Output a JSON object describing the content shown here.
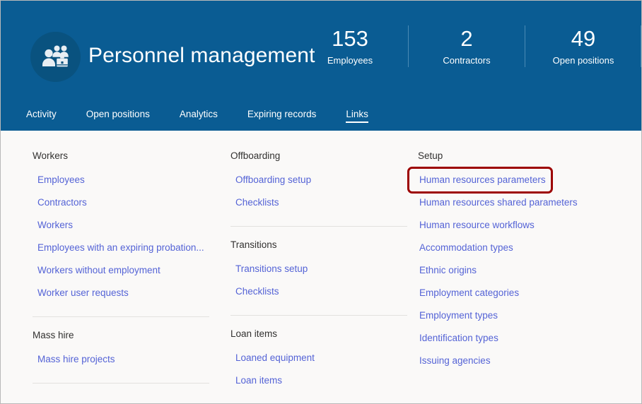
{
  "header": {
    "title": "Personnel management",
    "logo_icon": "people-briefcase-icon",
    "brand_color": "#0a5c93",
    "stats": [
      {
        "value": "153",
        "label": "Employees"
      },
      {
        "value": "2",
        "label": "Contractors"
      },
      {
        "value": "49",
        "label": "Open positions"
      }
    ]
  },
  "tabs": [
    {
      "label": "Activity",
      "active": false
    },
    {
      "label": "Open positions",
      "active": false
    },
    {
      "label": "Analytics",
      "active": false
    },
    {
      "label": "Expiring records",
      "active": false
    },
    {
      "label": "Links",
      "active": true
    }
  ],
  "link_color": "#5463d6",
  "highlight_color": "#9d0000",
  "columns": [
    {
      "name": "column-one",
      "groups": [
        {
          "title": "Workers",
          "links": [
            "Employees",
            "Contractors",
            "Workers",
            "Employees with an expiring probation...",
            "Workers without employment",
            "Worker user requests"
          ]
        },
        {
          "title": "Mass hire",
          "links": [
            "Mass hire projects"
          ]
        }
      ]
    },
    {
      "name": "column-two",
      "groups": [
        {
          "title": "Offboarding",
          "links": [
            "Offboarding setup",
            "Checklists"
          ]
        },
        {
          "title": "Transitions",
          "links": [
            "Transitions setup",
            "Checklists"
          ]
        },
        {
          "title": "Loan items",
          "links": [
            "Loaned equipment",
            "Loan items"
          ]
        }
      ]
    },
    {
      "name": "column-three",
      "groups": [
        {
          "title": "Setup",
          "links": [
            "Human resources parameters",
            "Human resources shared parameters",
            "Human resource workflows",
            "Accommodation types",
            "Ethnic origins",
            "Employment categories",
            "Employment types",
            "Identification types",
            "Issuing agencies"
          ]
        }
      ]
    }
  ],
  "highlighted_link": "Human resources parameters"
}
